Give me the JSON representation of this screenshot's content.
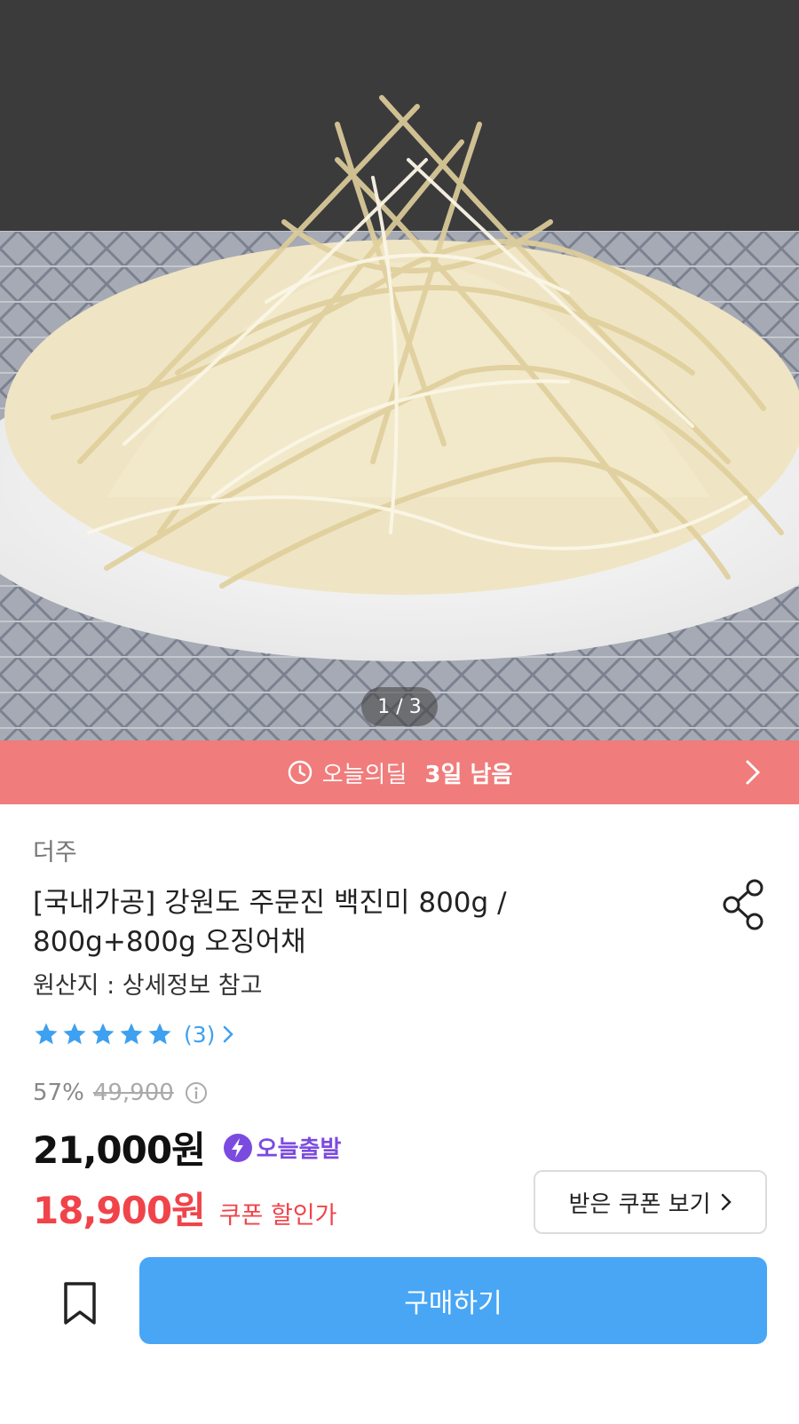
{
  "gallery": {
    "pager": "1 / 3",
    "image_icon": "photo-of-dried-squid-strips-on-plate"
  },
  "deal": {
    "icon": "clock-icon",
    "label": "오늘의딜",
    "remaining": "3일 남음",
    "bar_color": "#f07c7c"
  },
  "product": {
    "seller": "더주",
    "title": "[국내가공] 강원도 주문진 백진미 800g / 800g+800g 오징어채",
    "origin": "원산지 : 상세정보 참고"
  },
  "rating": {
    "stars": 5,
    "max": 5,
    "review_count": "(3)",
    "star_color": "#3ea0f0"
  },
  "pricing": {
    "discount_pct": "57%",
    "original_price": "49,900",
    "price": "21,000원",
    "today_badge": "오늘출발",
    "coupon_price": "18,900원",
    "coupon_label": "쿠폰 할인가"
  },
  "actions": {
    "coupon_button": "받은 쿠폰 보기",
    "buy_button": "구매하기",
    "buy_color": "#48a6f5"
  }
}
